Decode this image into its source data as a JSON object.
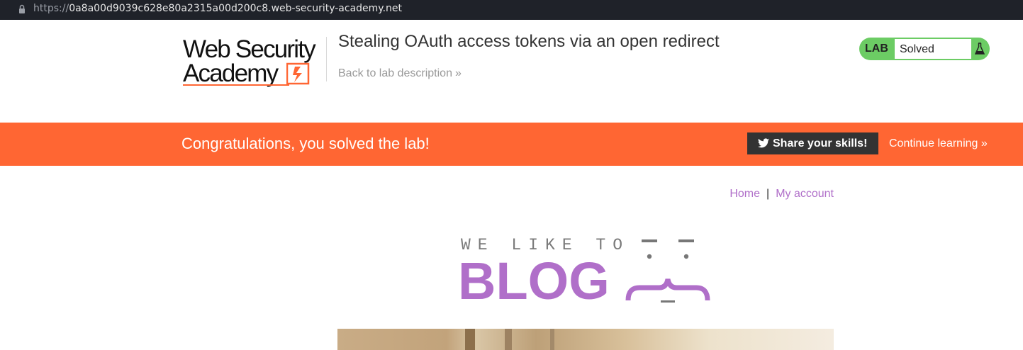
{
  "browser": {
    "url_scheme": "https://",
    "url_host": "0a8a00d9039c628e80a2315a00d200c8.web-security-academy.net"
  },
  "header": {
    "logo_line1": "Web Security",
    "logo_line2": "Academy",
    "lab_title": "Stealing OAuth access tokens via an open redirect",
    "back_link": "Back to lab description",
    "back_chevron": "»",
    "lab_tag": "LAB",
    "lab_status": "Solved"
  },
  "banner": {
    "message": "Congratulations, you solved the lab!",
    "share_label": "Share your skills!",
    "continue_label": "Continue learning",
    "continue_chevron": "»"
  },
  "nav": {
    "home": "Home",
    "separator": "|",
    "my_account": "My account"
  },
  "blog": {
    "tagline": "WE LIKE TO",
    "title": "BLOG"
  },
  "colors": {
    "accent_orange": "#ff6633",
    "lab_green": "#6ccc64",
    "link_purple": "#b06fc9"
  },
  "icons": {
    "lock": "lock-icon",
    "twitter": "twitter-bird-icon",
    "flask": "flask-icon"
  }
}
